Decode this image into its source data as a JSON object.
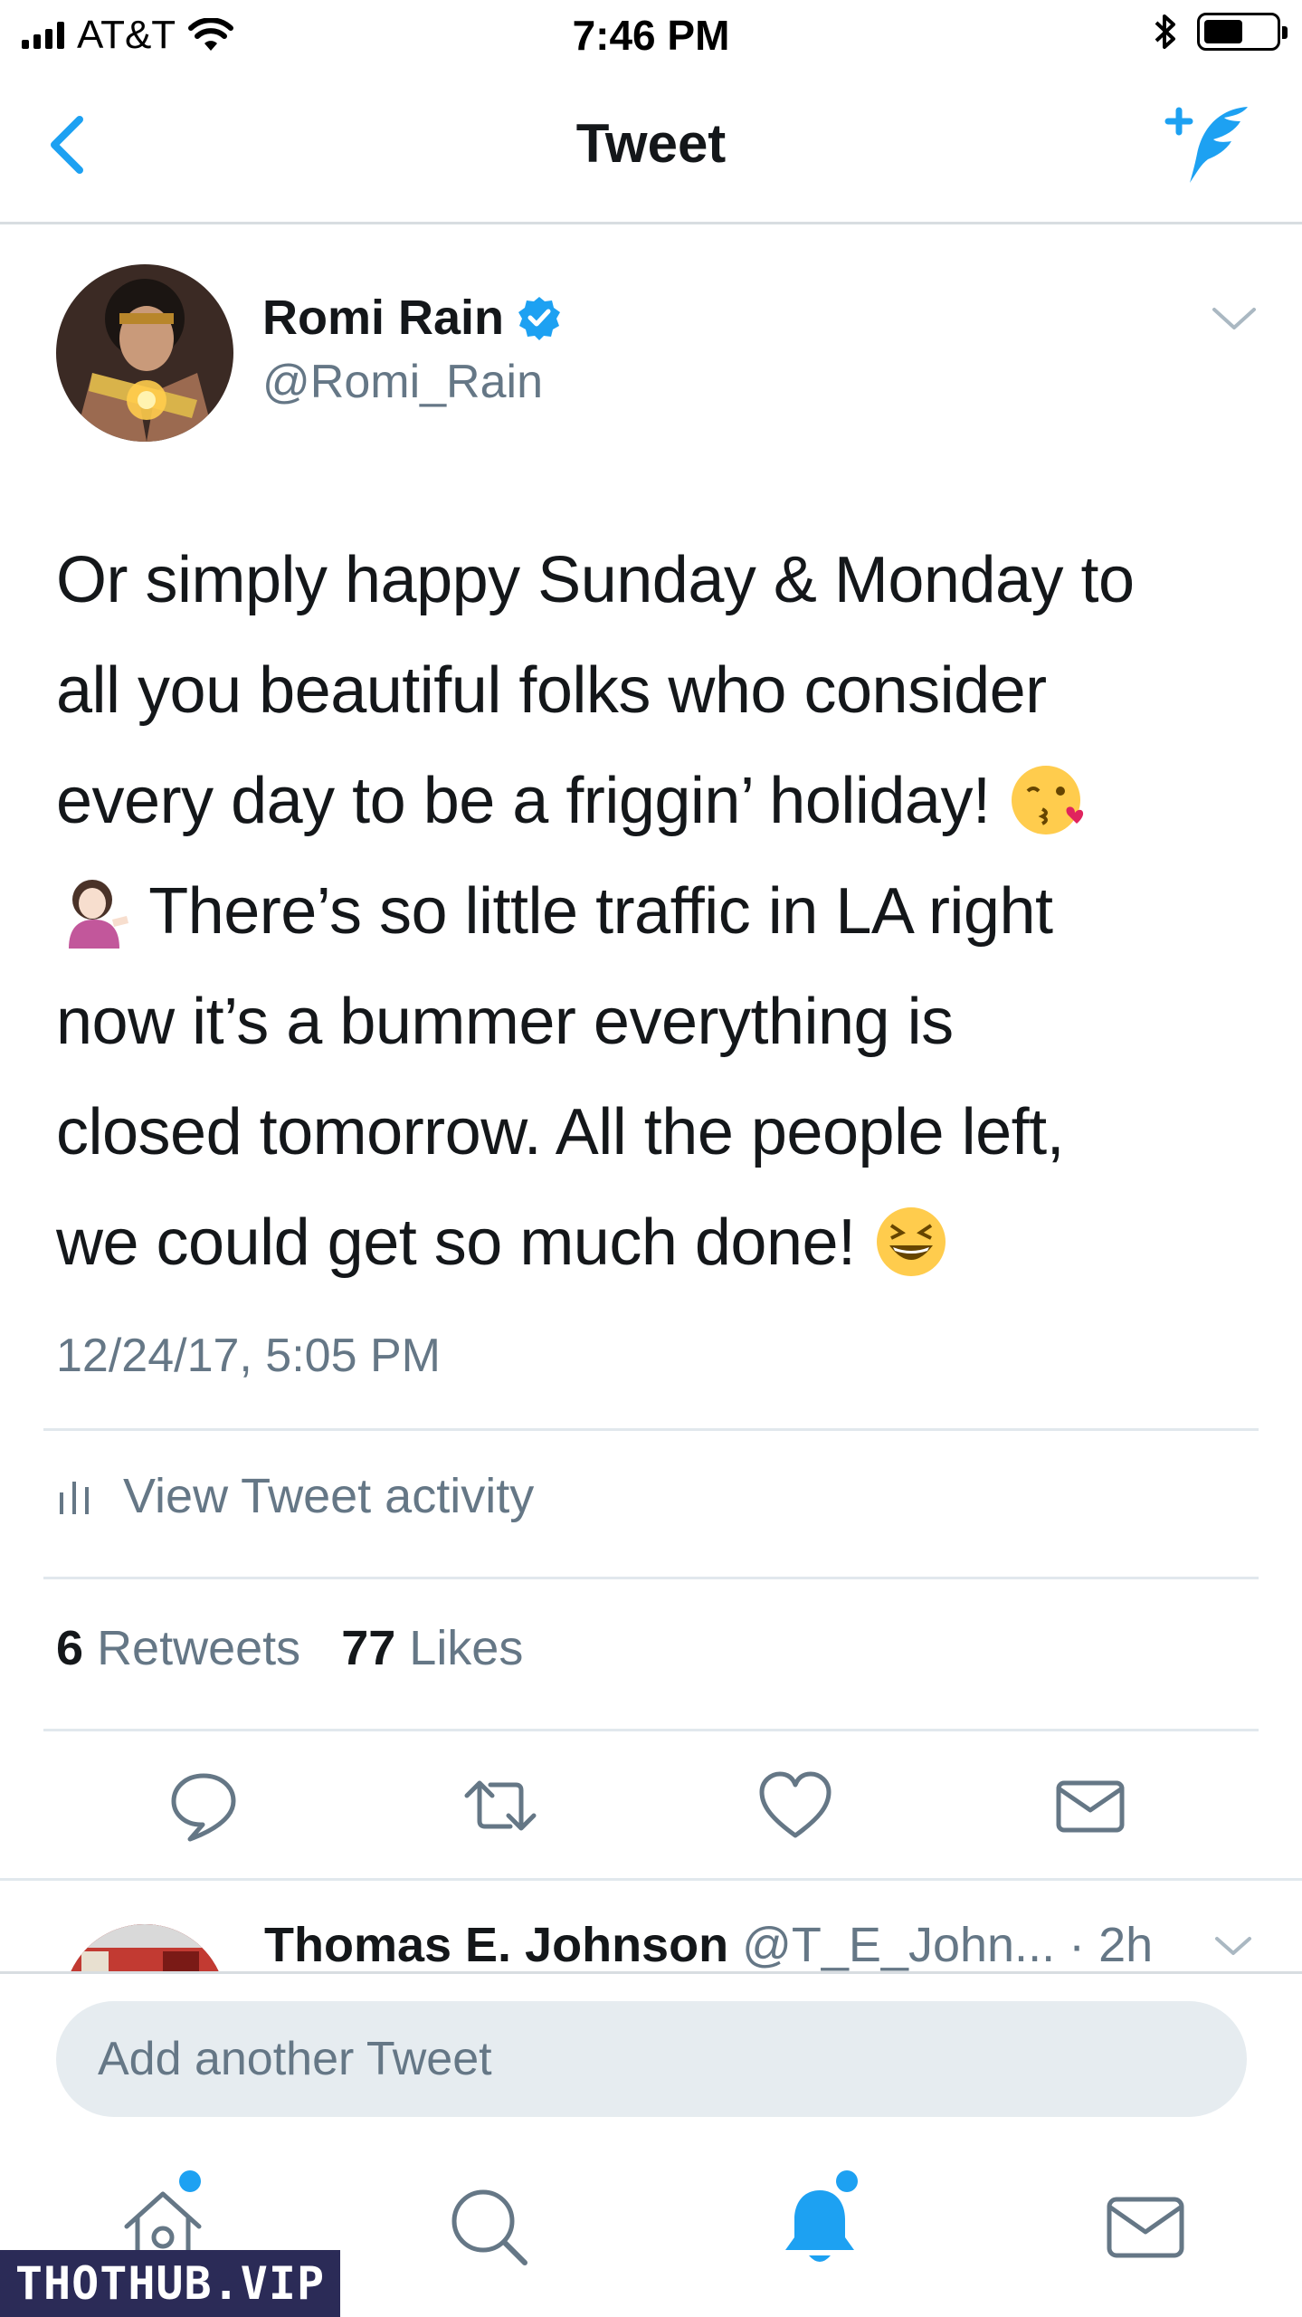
{
  "status_bar": {
    "carrier": "AT&T",
    "time": "7:46 PM"
  },
  "nav": {
    "title": "Tweet"
  },
  "tweet": {
    "author_name": "Romi Rain",
    "author_handle": "@Romi_Rain",
    "text_line_1": "Or simply happy Sunday & Monday to",
    "text_line_2": "all you beautiful folks who consider",
    "text_line_3": "every day to be a friggin’ holiday!",
    "text_line_4": "There’s so little traffic in LA right",
    "text_line_5": "now it’s a bummer everything is",
    "text_line_6": "closed tomorrow. All the people left,",
    "text_line_7": "we could get so much done!",
    "timestamp": "12/24/17, 5:05 PM",
    "activity_label": "View Tweet activity",
    "retweet_count": "6",
    "retweet_label": "Retweets",
    "like_count": "77",
    "like_label": "Likes"
  },
  "reply": {
    "name": "Thomas E. Johnson",
    "handle": "@T_E_John...",
    "age": "· 2h"
  },
  "composer": {
    "placeholder": "Add another Tweet"
  },
  "watermark": "THOTHUB.VIP",
  "colors": {
    "accent": "#1da1f2",
    "secondary_text": "#657786",
    "primary_text": "#14171a",
    "divider": "#e1e8ed"
  },
  "icons": [
    "back-chevron-icon",
    "compose-tweet-icon",
    "verified-badge-icon",
    "chevron-down-icon",
    "activity-bars-icon",
    "reply-icon",
    "retweet-icon",
    "like-heart-icon",
    "direct-message-icon",
    "home-icon",
    "search-icon",
    "notifications-bell-icon",
    "messages-icon"
  ]
}
